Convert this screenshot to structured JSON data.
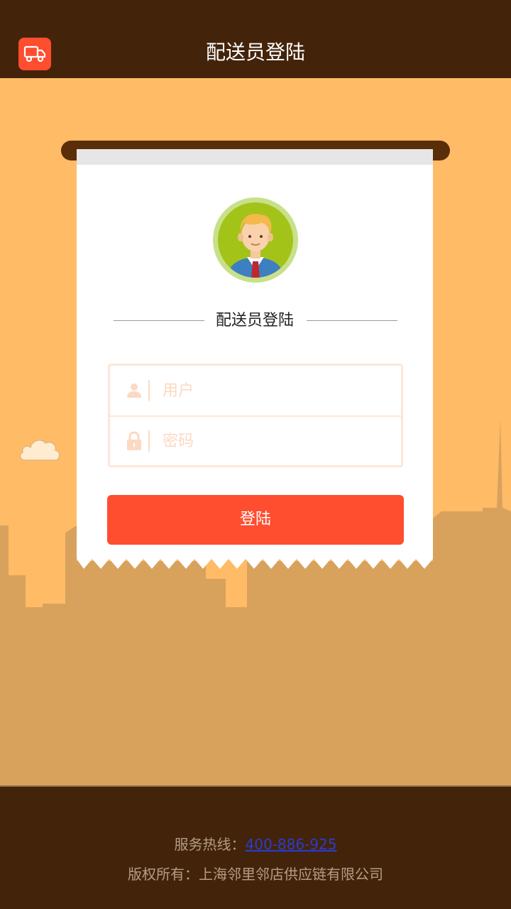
{
  "header": {
    "title": "配送员登陆",
    "icon": "delivery-truck-icon",
    "background_color": "#43240a",
    "icon_color": "#ff4d30"
  },
  "card": {
    "title": "配送员登陆",
    "avatar": "businessman-avatar",
    "username": {
      "placeholder": "用户",
      "value": "",
      "icon": "user-icon"
    },
    "password": {
      "placeholder": "密码",
      "value": "",
      "icon": "lock-icon"
    },
    "login_label": "登陆",
    "login_color": "#ff4d30"
  },
  "footer": {
    "hotline_label": "服务热线：",
    "hotline_number": "400-886-925",
    "copyright": "版权所有：上海邻里邻店供应链有限公司"
  },
  "colors": {
    "sky": "#ffbb66",
    "city": "#d8a25d",
    "footer": "#43240a"
  }
}
